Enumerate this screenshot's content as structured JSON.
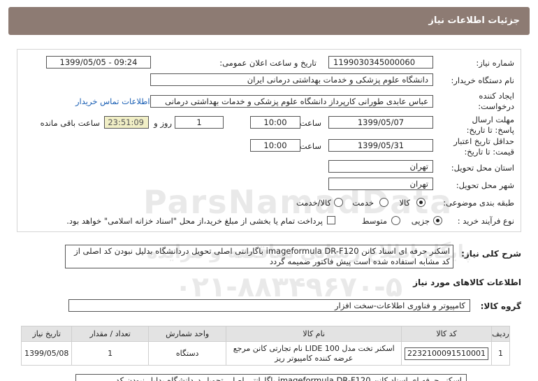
{
  "header": {
    "title": "جزئیات اطلاعات نیاز"
  },
  "form": {
    "need_number": {
      "label": "شماره نیاز:",
      "value": "1199030345000060"
    },
    "announce": {
      "label": "تاریخ و ساعت اعلان عمومی:",
      "value": "1399/05/05 - 09:24"
    },
    "buyer_org": {
      "label": "نام دستگاه خریدار:",
      "value": "دانشگاه علوم پزشکی و خدمات بهداشتی درمانی ایران"
    },
    "requester": {
      "label": "ایجاد کننده درخواست:",
      "value": "عباس عابدی طورانی کارپرداز دانشگاه علوم پزشکی و خدمات بهداشتی درمانی",
      "link": "اطلاعات تماس خریدار"
    },
    "deadline": {
      "label": "مهلت ارسال پاسخ: تا تاریخ:",
      "date": "1399/05/07",
      "time_label": "ساعت",
      "time": "10:00",
      "days": "1",
      "days_label": "روز و",
      "remaining": "23:51:09",
      "remaining_label": "ساعت باقی مانده"
    },
    "validity": {
      "label": "حداقل تاریخ اعتبار قیمت: تا تاریخ:",
      "date": "1399/05/31",
      "time_label": "ساعت",
      "time": "10:00"
    },
    "province": {
      "label": "استان محل تحویل:",
      "value": "تهران"
    },
    "city": {
      "label": "شهر محل تحویل:",
      "value": "تهران"
    },
    "category": {
      "label": "طبقه بندی موضوعی:",
      "options": [
        "کالا",
        "خدمت",
        "کالا/خدمت"
      ],
      "selected": "کالا"
    },
    "process": {
      "label": "نوع فرآیند خرید :",
      "options": [
        "جزیی",
        "متوسط"
      ],
      "selected": "جزیی",
      "note": "پرداخت تمام یا بخشی از مبلغ خرید،از محل \"اسناد خزانه اسلامی\" خواهد بود."
    }
  },
  "description": {
    "label": "شرح کلی نیاز:",
    "text": "اسکنر حرفه ای اسناد کانن imageformula DR-F120 باگارانتی اصلی تحویل دردانشگاه بدلیل نبودن کد اصلی از کد مشابه استفاده شده است پیش فاکتور ضمیمه گردد"
  },
  "goods_section": {
    "title": "اطلاعات کالاهای مورد نیاز"
  },
  "goods_group": {
    "label": "گروه کالا:",
    "value": "کامپیوتر و فناوری اطلاعات-سخت افزار"
  },
  "table": {
    "headers": [
      "ردیف",
      "کد کالا",
      "نام کالا",
      "واحد شمارش",
      "تعداد / مقدار",
      "تاریخ نیاز"
    ],
    "rows": [
      [
        "1",
        "2232100091510001",
        "اسکنر تخت مدل LIDE 100 نام تجارتی کانن مرجع عرضه کننده کامپیوتر ریز",
        "دستگاه",
        "1",
        "1399/05/08"
      ]
    ]
  },
  "bottom_text": "اسکنر حرفه ای اسناد کانن imageformula DR-F120 باگارانتی اصلی تحویل دردانشگاه بدلیل نبودن کد",
  "watermark": {
    "brand": "ParsNamadData",
    "line1": "پایگاه اطلاع رسانی مناقصه و مزایده",
    "phone": "۰۲۱-۸۸۳۴۹۶۷۰-۵"
  }
}
